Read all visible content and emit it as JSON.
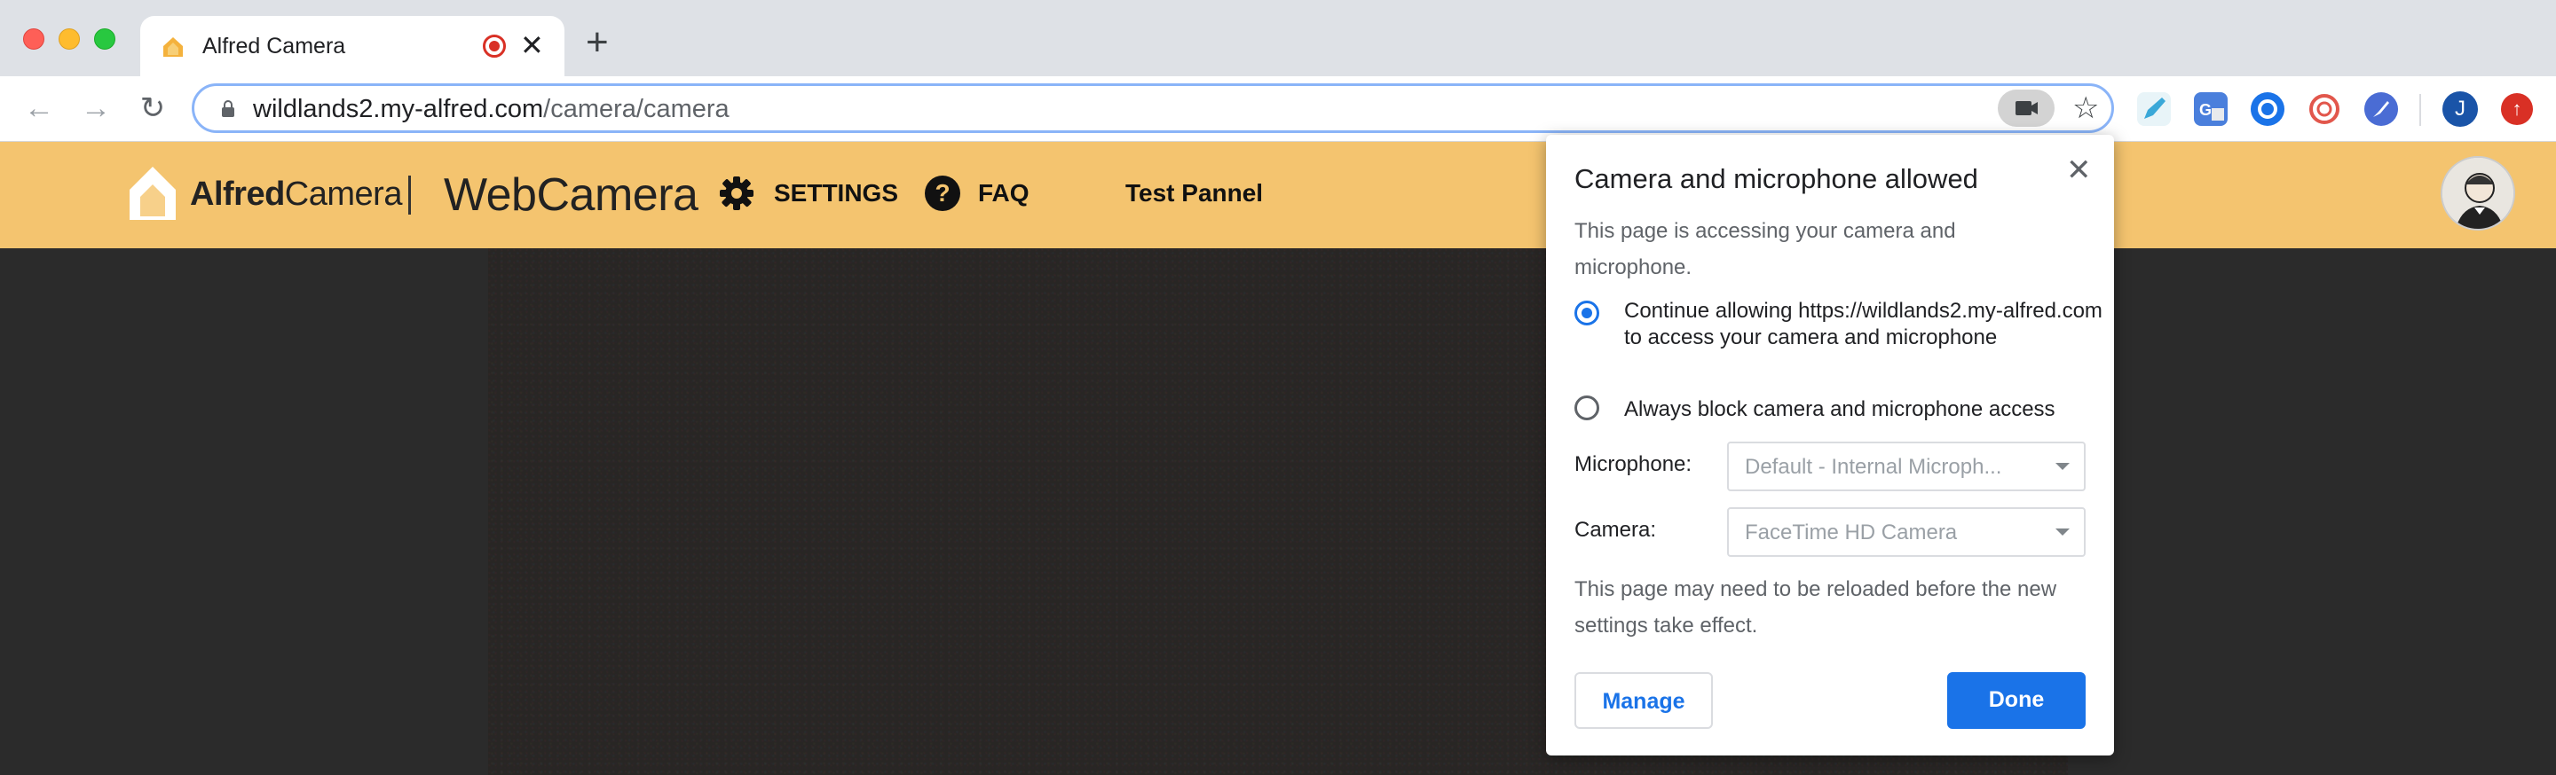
{
  "browser": {
    "tab": {
      "title": "Alfred Camera",
      "favicon": "alfred-house-icon"
    },
    "address": {
      "host": "wildlands2.my-alfred.com",
      "path": "/camera/camera"
    },
    "profile_initial": "J"
  },
  "site": {
    "brand_bold": "Alfred",
    "brand_light": "Camera",
    "brand_product": "WebCamera",
    "nav": [
      {
        "label": "SETTINGS",
        "icon": "gear-icon"
      },
      {
        "label": "FAQ",
        "icon": "question-icon"
      },
      {
        "label": "Test Pannel"
      }
    ],
    "accent_color": "#f4c46f"
  },
  "permission_popup": {
    "title": "Camera and microphone allowed",
    "description": "This page is accessing your camera and microphone.",
    "options": [
      {
        "label": "Continue allowing https://wildlands2.my-alfred.com to access your camera and microphone",
        "selected": true
      },
      {
        "label": "Always block camera and microphone access",
        "selected": false
      }
    ],
    "microphone": {
      "label": "Microphone:",
      "value": "Default - Internal Microph..."
    },
    "camera": {
      "label": "Camera:",
      "value": "FaceTime HD Camera"
    },
    "note": "This page may need to be reloaded before the new settings take effect.",
    "manage_label": "Manage",
    "done_label": "Done",
    "primary_color": "#1a73e8"
  }
}
